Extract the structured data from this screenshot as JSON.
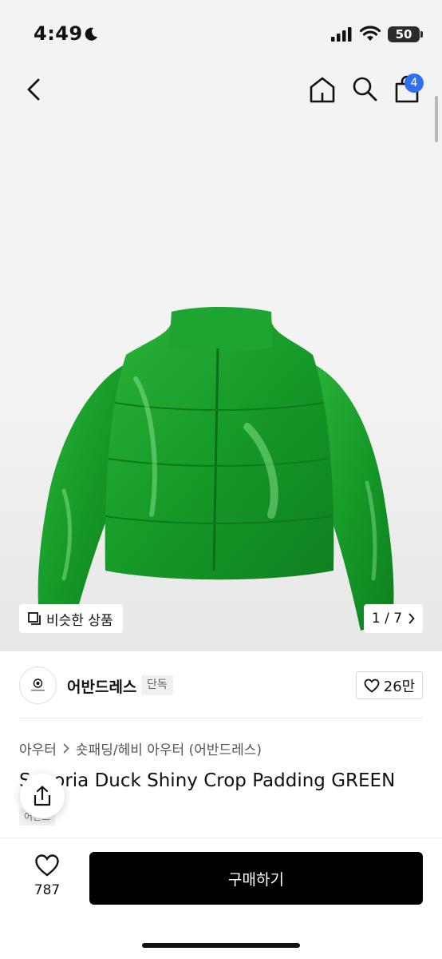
{
  "status_bar": {
    "time": "4:49",
    "battery": "50",
    "icons": [
      "moon-icon",
      "signal-icon",
      "wifi-icon",
      "battery-icon"
    ]
  },
  "header": {
    "icons": [
      "back-icon",
      "home-icon",
      "search-icon",
      "bag-icon"
    ],
    "cart_count": "4"
  },
  "gallery": {
    "similar_label": "비슷한 상품",
    "pager": "1 / 7",
    "image": "green shiny crop padding jacket"
  },
  "brand": {
    "name": "어반드레스",
    "tag": "단독",
    "likes": "26만"
  },
  "product": {
    "category_1": "아우터",
    "category_2": "숏패딩/헤비 아우터 (어반드레스)",
    "title": "Sonoria Duck Shiny Crop Padding GREEN",
    "tag": "어반드"
  },
  "bottom": {
    "wish_count": "787",
    "buy_label": "구매하기"
  },
  "colors": {
    "accent_blue": "#2f6ff0",
    "jacket_green": "#1f9a2c",
    "buy_button": "#000000"
  }
}
